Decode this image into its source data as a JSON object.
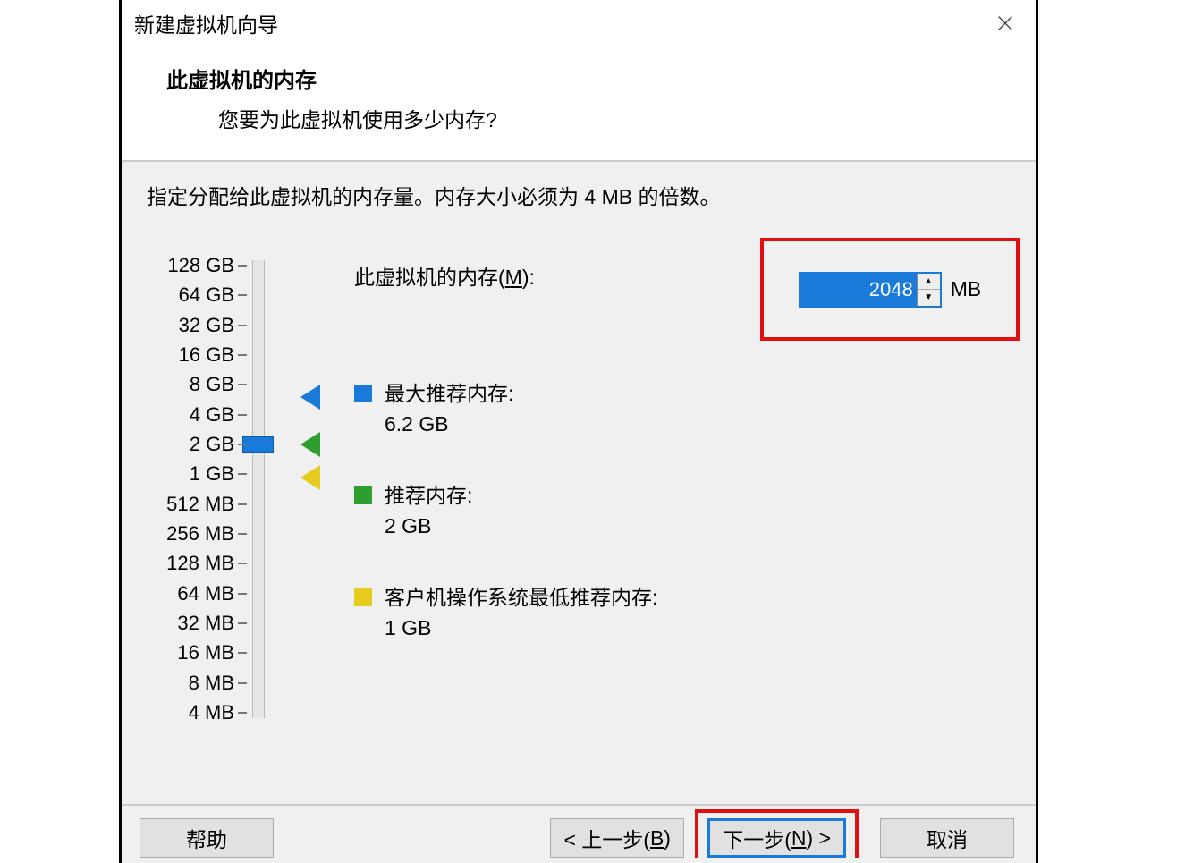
{
  "window": {
    "title": "新建虚拟机向导"
  },
  "header": {
    "title": "此虚拟机的内存",
    "subtitle": "您要为此虚拟机使用多少内存?"
  },
  "instruction": "指定分配给此虚拟机的内存量。内存大小必须为 4 MB 的倍数。",
  "memory_input": {
    "label_prefix": "此虚拟机的内存(",
    "label_hotkey": "M",
    "label_suffix": "):",
    "value": "2048",
    "unit": "MB"
  },
  "slider": {
    "ticks": [
      "128 GB",
      "64 GB",
      "32 GB",
      "16 GB",
      "8 GB",
      "4 GB",
      "2 GB",
      "1 GB",
      "512 MB",
      "256 MB",
      "128 MB",
      "64 MB",
      "32 MB",
      "16 MB",
      "8 MB",
      "4 MB"
    ],
    "current_index": 6,
    "markers": {
      "max_recommended_index": 4.4,
      "recommended_index": 6,
      "min_index": 7.1
    }
  },
  "legend": {
    "max": {
      "label": "最大推荐内存:",
      "value": "6.2 GB"
    },
    "rec": {
      "label": "推荐内存:",
      "value": "2 GB"
    },
    "min": {
      "label": "客户机操作系统最低推荐内存:",
      "value": "1 GB"
    }
  },
  "buttons": {
    "help": "帮助",
    "back_1": "< 上一步(",
    "back_h": "B",
    "back_2": ")",
    "next_1": "下一步(",
    "next_h": "N",
    "next_2": ") >",
    "cancel": "取消"
  }
}
